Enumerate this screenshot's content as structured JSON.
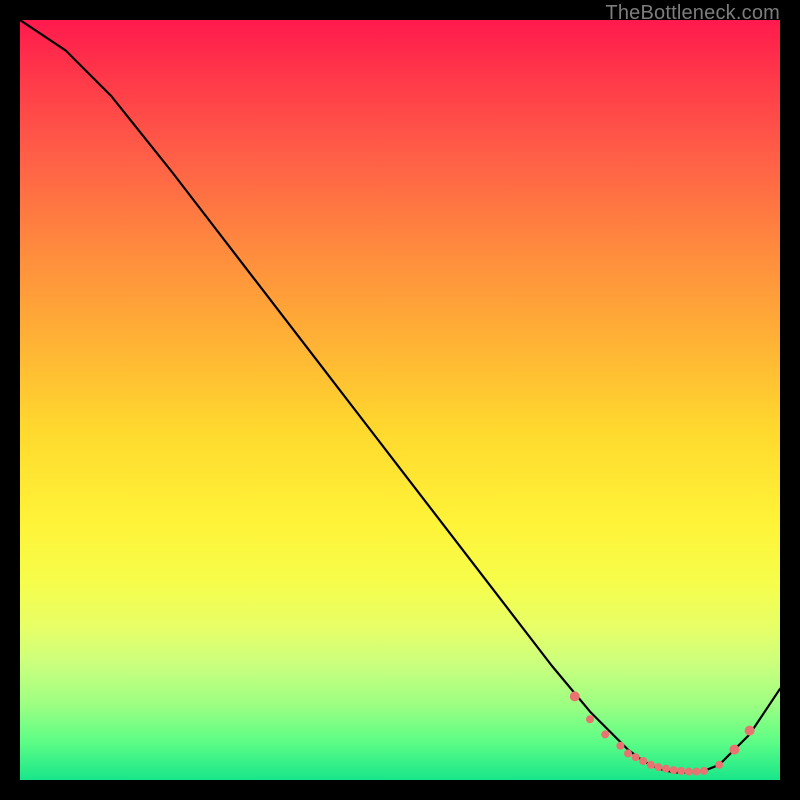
{
  "attribution": "TheBottleneck.com",
  "chart_data": {
    "type": "line",
    "title": "",
    "xlabel": "",
    "ylabel": "",
    "xlim": [
      0,
      100
    ],
    "ylim": [
      0,
      100
    ],
    "series": [
      {
        "name": "curve",
        "x": [
          0,
          6,
          12,
          20,
          30,
          40,
          50,
          60,
          70,
          75,
          80,
          82,
          84,
          86,
          88,
          90,
          92,
          96,
          100
        ],
        "values": [
          100,
          96,
          90,
          80,
          67,
          54,
          41,
          28,
          15,
          9,
          4,
          2.5,
          1.5,
          1,
          1,
          1.2,
          2,
          6,
          12
        ]
      }
    ],
    "markers": {
      "name": "highlight-dots",
      "color": "#e87370",
      "x": [
        73,
        75,
        77,
        79,
        80,
        81,
        82,
        83,
        84,
        85,
        86,
        87,
        88,
        89,
        90,
        92,
        94,
        96
      ],
      "values": [
        11,
        8,
        6,
        4.5,
        3.5,
        3,
        2.5,
        2,
        1.7,
        1.5,
        1.3,
        1.2,
        1.1,
        1.1,
        1.2,
        2,
        4,
        6.5
      ]
    }
  }
}
